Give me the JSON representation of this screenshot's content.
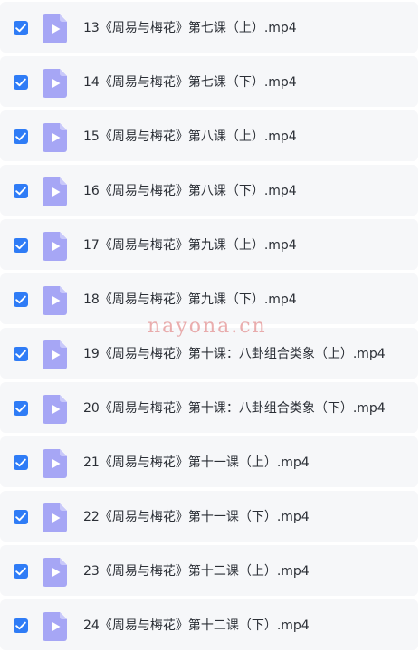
{
  "colors": {
    "row_bg": "#f6f7f9",
    "checkbox": "#2f7cf6",
    "video_icon": "#a6a6f5",
    "text": "#2b2f36",
    "watermark": "#dc6e6e"
  },
  "icons": {
    "checkbox": "checkmark-icon",
    "file": "video-file-icon"
  },
  "watermark": "nayona.cn",
  "files": [
    {
      "name": "13《周易与梅花》第七课（上）.mp4",
      "checked": true
    },
    {
      "name": "14《周易与梅花》第七课（下）.mp4",
      "checked": true
    },
    {
      "name": "15《周易与梅花》第八课（上）.mp4",
      "checked": true
    },
    {
      "name": "16《周易与梅花》第八课（下）.mp4",
      "checked": true
    },
    {
      "name": "17《周易与梅花》第九课（上）.mp4",
      "checked": true
    },
    {
      "name": "18《周易与梅花》第九课（下）.mp4",
      "checked": true
    },
    {
      "name": "19《周易与梅花》第十课：八卦组合类象（上）.mp4",
      "checked": true
    },
    {
      "name": "20《周易与梅花》第十课：八卦组合类象（下）.mp4",
      "checked": true
    },
    {
      "name": "21《周易与梅花》第十一课（上）.mp4",
      "checked": true
    },
    {
      "name": "22《周易与梅花》第十一课（下）.mp4",
      "checked": true
    },
    {
      "name": "23《周易与梅花》第十二课（上）.mp4",
      "checked": true
    },
    {
      "name": "24《周易与梅花》第十二课（下）.mp4",
      "checked": true
    }
  ]
}
